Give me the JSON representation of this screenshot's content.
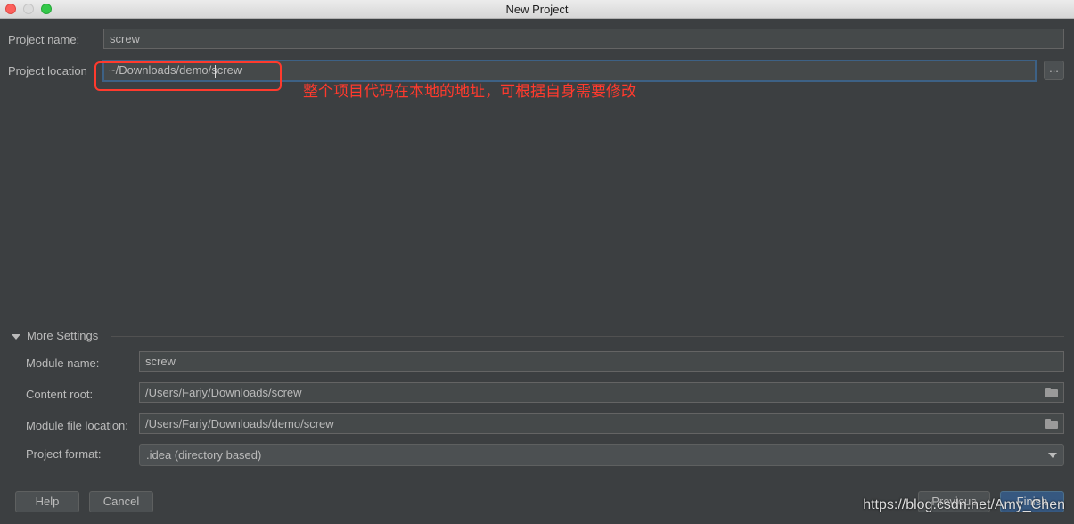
{
  "window": {
    "title": "New Project"
  },
  "project": {
    "name_label": "Project name:",
    "name_value": "screw",
    "location_label": "Project location",
    "location_value": "~/Downloads/demo/screw",
    "browse_label": "...",
    "annotation": "整个项目代码在本地的地址，可根据自身需要修改"
  },
  "more_settings": {
    "header": "More Settings",
    "module_name_label": "Module name:",
    "module_name_value": "screw",
    "content_root_label": "Content root:",
    "content_root_value": "/Users/Fariy/Downloads/screw",
    "module_file_label": "Module file location:",
    "module_file_value": "/Users/Fariy/Downloads/demo/screw",
    "project_format_label": "Project format:",
    "project_format_value": ".idea (directory based)"
  },
  "buttons": {
    "help": "Help",
    "cancel": "Cancel",
    "previous": "Previous",
    "finish": "Finish"
  },
  "watermark": "https://blog.csdn.net/Amy_Chen",
  "colors": {
    "background": "#3c3f41",
    "field": "#45494a",
    "annotation": "#ff3a2d",
    "primary_button": "#365880"
  },
  "icons": [
    "close-light",
    "minimize-light",
    "zoom-light",
    "folder-icon",
    "chevron-down-icon"
  ]
}
